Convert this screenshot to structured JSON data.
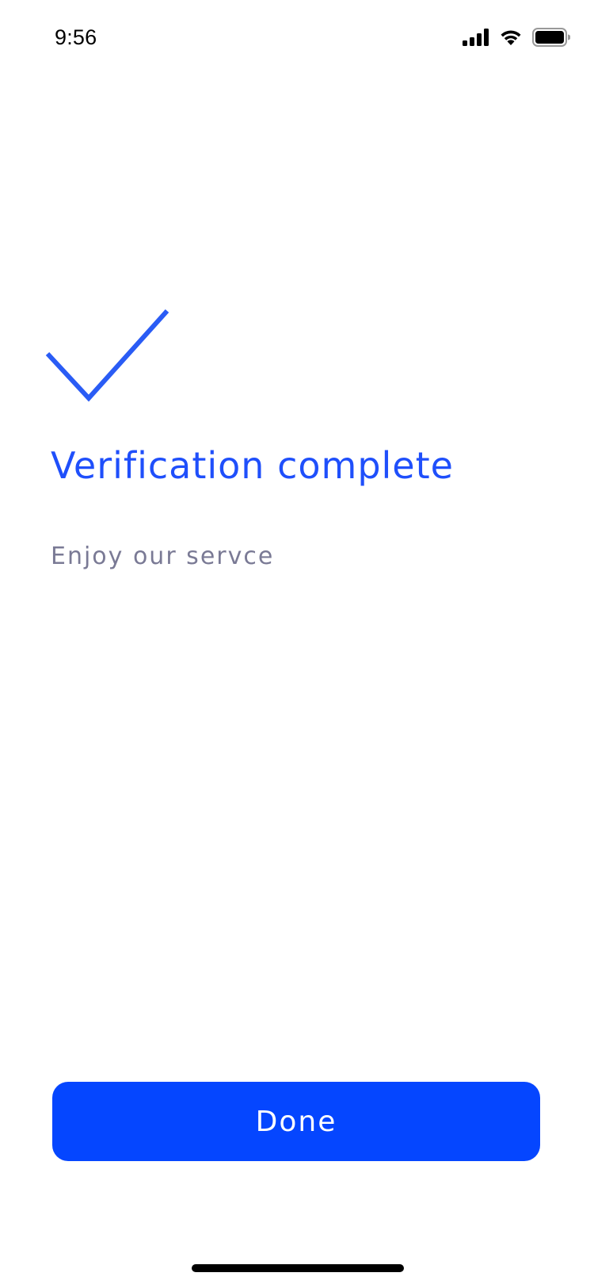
{
  "status_bar": {
    "time": "9:56",
    "icons": [
      "cellular-signal-icon",
      "wifi-icon",
      "battery-icon"
    ]
  },
  "main": {
    "icon": "checkmark-icon",
    "title": "Verification complete",
    "subtitle": "Enjoy our servce"
  },
  "actions": {
    "done_label": "Done"
  },
  "colors": {
    "accent": "#0546ff",
    "title": "#1f4ffb",
    "subtitle": "#7a7a95",
    "background": "#ffffff"
  }
}
